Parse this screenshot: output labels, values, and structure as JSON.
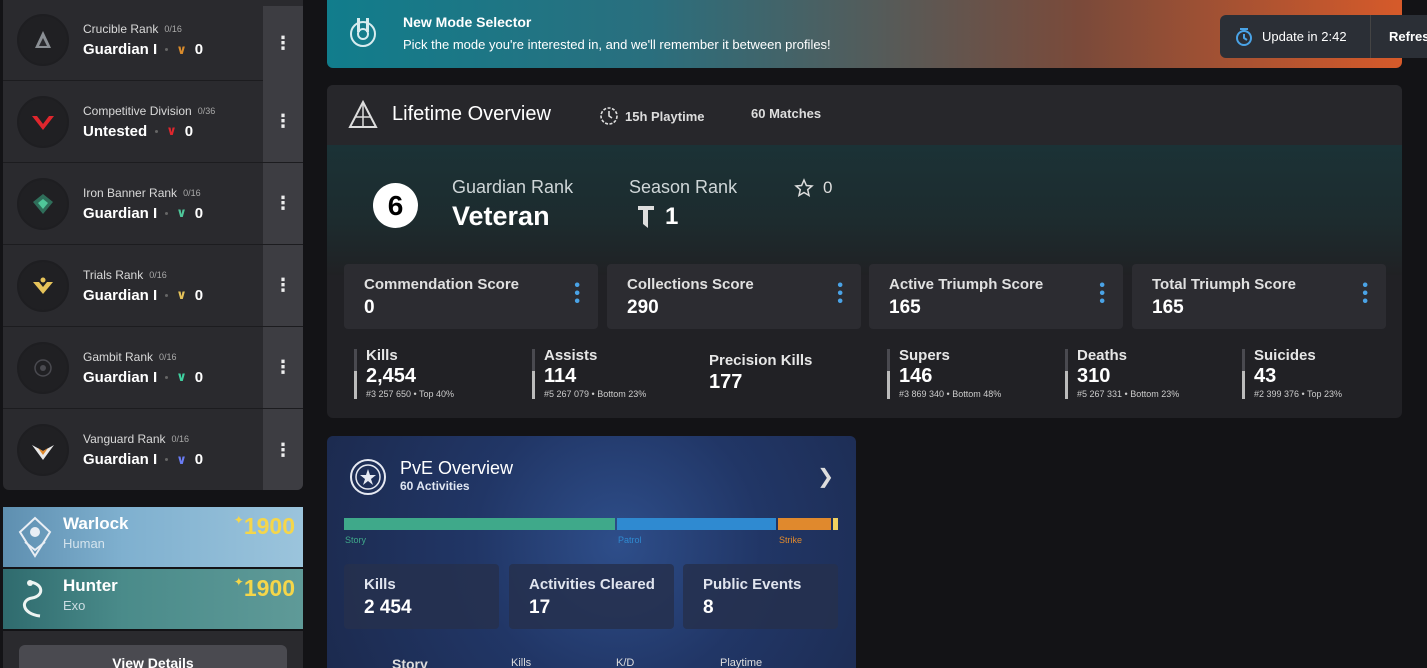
{
  "ranks": [
    {
      "name": "Crucible Rank",
      "count": "0/16",
      "tier": "Guardian I",
      "points": "0",
      "color": "#d98b2b"
    },
    {
      "name": "Competitive Division",
      "count": "0/36",
      "tier": "Untested",
      "points": "0",
      "color": "#e0262d"
    },
    {
      "name": "Iron Banner Rank",
      "count": "0/16",
      "tier": "Guardian I",
      "points": "0",
      "color": "#4fc79a"
    },
    {
      "name": "Trials Rank",
      "count": "0/16",
      "tier": "Guardian I",
      "points": "0",
      "color": "#e6c35a"
    },
    {
      "name": "Gambit Rank",
      "count": "0/16",
      "tier": "Guardian I",
      "points": "0",
      "color": "#3fd1a0"
    },
    {
      "name": "Vanguard Rank",
      "count": "0/16",
      "tier": "Guardian I",
      "points": "0",
      "color": "#6a7cf5"
    }
  ],
  "characters": [
    {
      "cls": "Warlock",
      "race": "Human",
      "light": "1900"
    },
    {
      "cls": "Hunter",
      "race": "Exo",
      "light": "1900"
    }
  ],
  "view_details": "View Details",
  "banner": {
    "title": "New Mode Selector",
    "subtitle": "Pick the mode you're interested in, and we'll remember it between profiles!",
    "update": "Update in 2:42",
    "refresh": "Refresh"
  },
  "lifetime": {
    "title": "Lifetime Overview",
    "playtime": "15h Playtime",
    "matches": "60 Matches",
    "guardian_rank_num": "6",
    "guardian_rank_label": "Guardian Rank",
    "guardian_rank_value": "Veteran",
    "season_rank_label": "Season Rank",
    "season_rank_value": "1",
    "star_value": "0",
    "scores": [
      {
        "label": "Commendation Score",
        "value": "0"
      },
      {
        "label": "Collections Score",
        "value": "290"
      },
      {
        "label": "Active Triumph Score",
        "value": "165"
      },
      {
        "label": "Total Triumph Score",
        "value": "165"
      }
    ],
    "stats": [
      {
        "label": "Kills",
        "value": "2,454",
        "sub": "#3 257 650 • Top 40%"
      },
      {
        "label": "Assists",
        "value": "114",
        "sub": "#5 267 079 • Bottom 23%"
      },
      {
        "label": "Precision Kills",
        "value": "177",
        "sub": ""
      },
      {
        "label": "Supers",
        "value": "146",
        "sub": "#3 869 340 • Bottom 48%"
      },
      {
        "label": "Deaths",
        "value": "310",
        "sub": "#5 267 331 • Bottom 23%"
      },
      {
        "label": "Suicides",
        "value": "43",
        "sub": "#2 399 376 • Top 23%"
      }
    ]
  },
  "pve": {
    "title": "PvE Overview",
    "subtitle": "60 Activities",
    "bar": [
      {
        "label": "Story",
        "color": "#3fa98a",
        "fraction": 0.55
      },
      {
        "label": "Patrol",
        "color": "#2f8ad1",
        "fraction": 0.325
      },
      {
        "label": "Strike",
        "color": "#e0892d",
        "fraction": 0.11
      },
      {
        "label": "",
        "color": "#f0d060",
        "fraction": 0.015
      }
    ],
    "cards": [
      {
        "label": "Kills",
        "value": "2 454"
      },
      {
        "label": "Activities Cleared",
        "value": "17"
      },
      {
        "label": "Public Events",
        "value": "8"
      }
    ],
    "footer": {
      "story": "Story",
      "kills": "Kills",
      "kd": "K/D",
      "playtime": "Playtime"
    }
  }
}
